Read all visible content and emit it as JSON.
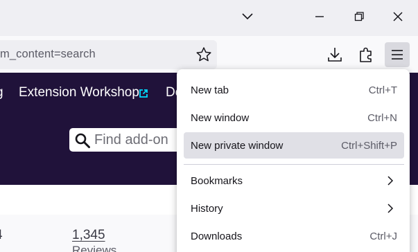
{
  "window": {
    "controls": {
      "tab_list_icon": "chevron-down-icon",
      "minimize_icon": "minimize-icon",
      "restore_icon": "restore-icon",
      "close_icon": "close-icon"
    }
  },
  "toolbar": {
    "url_text": "m_content=search",
    "bookmark_icon": "star-icon",
    "downloads_icon": "download-icon",
    "extensions_icon": "puzzle-icon",
    "menu_icon": "hamburger-icon"
  },
  "page": {
    "header_colors": {
      "background": "#20123a",
      "link_icon_color": "#00ddff"
    },
    "header_fragment": "g",
    "extension_workshop_label": "Extension Workshop",
    "developer_fragment": "De",
    "search": {
      "placeholder": "Find add-on"
    },
    "stat_fragment": "4",
    "review_count": "1,345",
    "review_label": "Reviews"
  },
  "app_menu": {
    "items": [
      {
        "label": "New tab",
        "shortcut": "Ctrl+T"
      },
      {
        "label": "New window",
        "shortcut": "Ctrl+N"
      },
      {
        "label": "New private window",
        "shortcut": "Ctrl+Shift+P",
        "highlighted": true
      },
      {
        "label": "Bookmarks",
        "submenu": true
      },
      {
        "label": "History",
        "submenu": true
      },
      {
        "label": "Downloads",
        "shortcut": "Ctrl+J"
      }
    ]
  }
}
